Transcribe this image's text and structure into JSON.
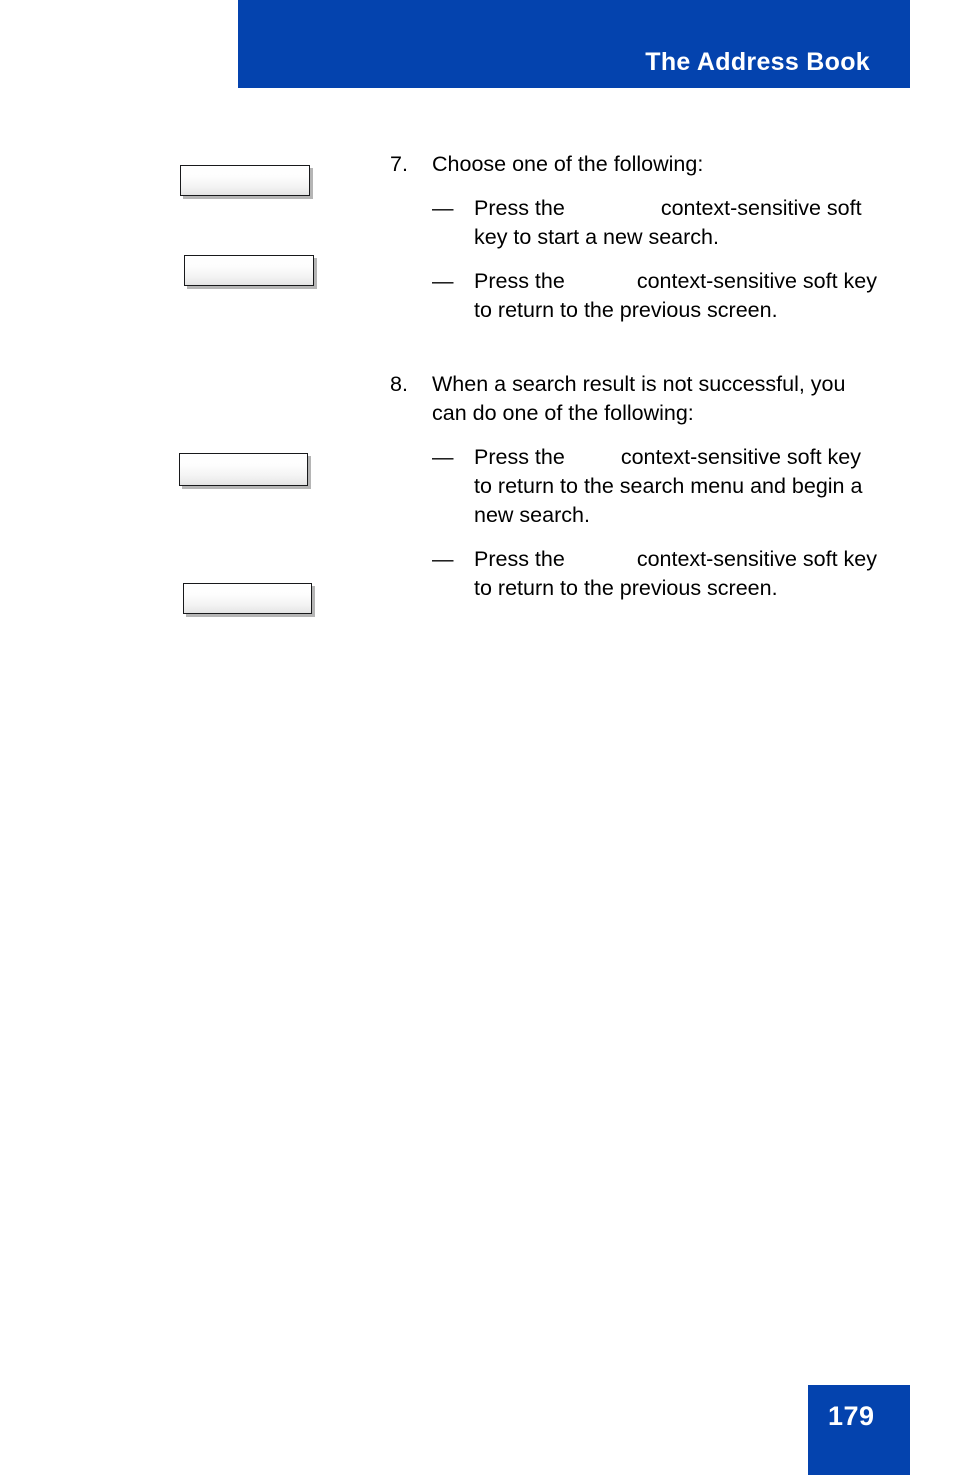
{
  "document": {
    "running_header": "The Address Book",
    "page_number": "179",
    "header_color": "#0443ae",
    "page_badge_color": "#0443ae",
    "text_color": "#000000",
    "background_color": "#ffffff"
  },
  "margin_graphics": [
    {
      "name": "softkey-graphic-1",
      "label": ""
    },
    {
      "name": "softkey-graphic-2",
      "label": ""
    },
    {
      "name": "softkey-graphic-3",
      "label": ""
    },
    {
      "name": "softkey-graphic-4",
      "label": ""
    }
  ],
  "steps": [
    {
      "number": "7.",
      "text": "Choose one of the following:",
      "bullets": [
        {
          "dash": "—",
          "lead": "Press the",
          "inline_softkey_label": "",
          "trail": "context-sensitive soft key to start a new search."
        },
        {
          "dash": "—",
          "lead": "Press the",
          "inline_softkey_label": "",
          "trail": "context-sensitive soft key to return to the previous screen."
        }
      ]
    },
    {
      "number": "8.",
      "text": "When a search result is not successful, you can do one of the following:",
      "bullets": [
        {
          "dash": "—",
          "lead": "Press the",
          "inline_softkey_label": "",
          "trail": "context-sensitive soft key to return to the search menu and begin a new search."
        },
        {
          "dash": "—",
          "lead": "Press the",
          "inline_softkey_label": "",
          "trail": "context-sensitive soft key to return to the previous screen."
        }
      ]
    }
  ]
}
